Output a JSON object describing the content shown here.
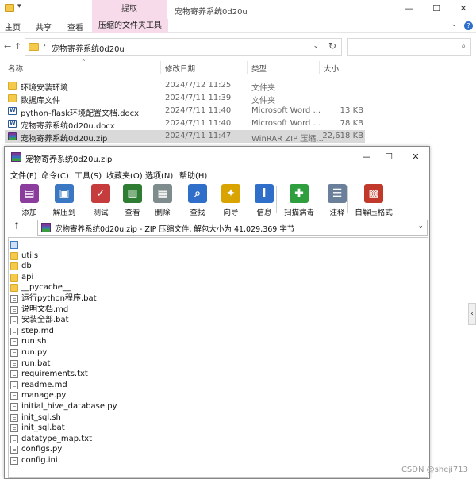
{
  "explorer": {
    "title": "宠物寄养系统0d20u",
    "context_tab": "提取",
    "ribbon_tabs": [
      "主页",
      "共享",
      "查看"
    ],
    "ribbon_context_tab": "压缩的文件夹工具",
    "address": "宠物寄养系统0d20u",
    "search_placeholder": "",
    "columns": {
      "name": "名称",
      "date": "修改日期",
      "type": "类型",
      "size": "大小"
    },
    "files": [
      {
        "name": "环境安装环境",
        "date": "2024/7/12 11:25",
        "type": "文件夹",
        "size": "",
        "icon": "folder-icon"
      },
      {
        "name": "数据库文件",
        "date": "2024/7/11 11:39",
        "type": "文件夹",
        "size": "",
        "icon": "folder-icon"
      },
      {
        "name": "python-flask环境配置文档.docx",
        "date": "2024/7/11 11:40",
        "type": "Microsoft Word ...",
        "size": "13 KB",
        "icon": "word-document-icon"
      },
      {
        "name": "宠物寄养系统0d20u.docx",
        "date": "2024/7/11 11:40",
        "type": "Microsoft Word ...",
        "size": "78 KB",
        "icon": "word-document-icon"
      },
      {
        "name": "宠物寄养系统0d20u.zip",
        "date": "2024/7/11 11:47",
        "type": "WinRAR ZIP 压缩...",
        "size": "22,618 KB",
        "icon": "winrar-archive-icon",
        "selected": true
      }
    ]
  },
  "winrar": {
    "title": "宠物寄养系统0d20u.zip",
    "menu": [
      "文件(F)",
      "命令(C)",
      "工具(S)",
      "收藏夹(O)",
      "选项(N)",
      "帮助(H)"
    ],
    "toolbar": [
      {
        "label": "添加",
        "icon": "add-archive-icon",
        "color": "#8b3d9e"
      },
      {
        "label": "解压到",
        "icon": "extract-folder-icon",
        "color": "#3b78c4"
      },
      {
        "label": "测试",
        "icon": "test-clipboard-icon",
        "color": "#c63b3b"
      },
      {
        "label": "查看",
        "icon": "view-book-icon",
        "color": "#2e7d32"
      },
      {
        "label": "删除",
        "icon": "trash-icon",
        "color": "#7f8c8d"
      },
      {
        "label": "查找",
        "icon": "magnifier-icon",
        "color": "#2f6ec9"
      },
      {
        "label": "向导",
        "icon": "wizard-wand-icon",
        "color": "#d9a400"
      },
      {
        "label": "信息",
        "icon": "info-icon",
        "color": "#2f6ec9"
      },
      {
        "label": "扫描病毒",
        "icon": "virus-scan-icon",
        "color": "#2e9e3e"
      },
      {
        "label": "注释",
        "icon": "comment-icon",
        "color": "#6a7f99"
      },
      {
        "label": "自解压格式",
        "icon": "sfx-box-icon",
        "color": "#c0392b"
      }
    ],
    "path": "宠物寄养系统0d20u.zip - ZIP 压缩文件, 解包大小为 41,029,369 字节",
    "entries": [
      {
        "name": "",
        "kind": "parent",
        "selected": true
      },
      {
        "name": "utils",
        "kind": "folder"
      },
      {
        "name": "db",
        "kind": "folder"
      },
      {
        "name": "api",
        "kind": "folder"
      },
      {
        "name": "__pycache__",
        "kind": "folder"
      },
      {
        "name": "运行python程序.bat",
        "kind": "file"
      },
      {
        "name": "说明文档.md",
        "kind": "file"
      },
      {
        "name": "安装全部.bat",
        "kind": "file"
      },
      {
        "name": "step.md",
        "kind": "file"
      },
      {
        "name": "run.sh",
        "kind": "file"
      },
      {
        "name": "run.py",
        "kind": "file"
      },
      {
        "name": "run.bat",
        "kind": "file"
      },
      {
        "name": "requirements.txt",
        "kind": "file"
      },
      {
        "name": "readme.md",
        "kind": "file"
      },
      {
        "name": "manage.py",
        "kind": "file"
      },
      {
        "name": "initial_hive_database.py",
        "kind": "file"
      },
      {
        "name": "init_sql.sh",
        "kind": "file"
      },
      {
        "name": "init_sql.bat",
        "kind": "file"
      },
      {
        "name": "datatype_map.txt",
        "kind": "file"
      },
      {
        "name": "configs.py",
        "kind": "file"
      },
      {
        "name": "config.ini",
        "kind": "file"
      }
    ]
  },
  "watermark": "CSDN @shejì713"
}
